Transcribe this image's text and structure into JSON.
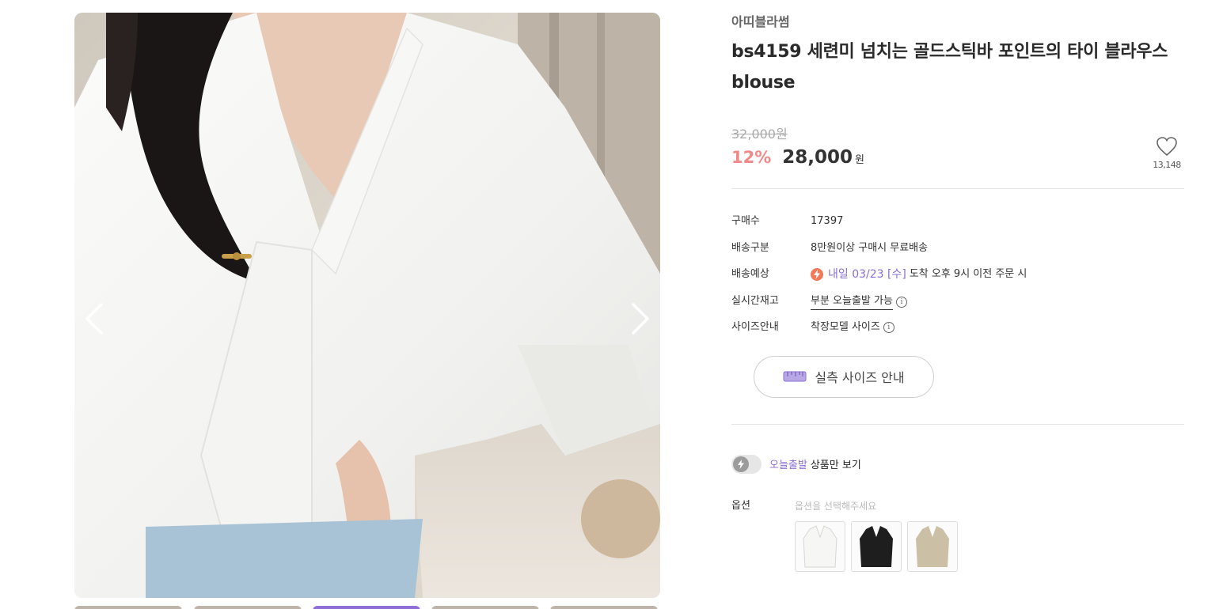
{
  "product": {
    "brand": "아띠블라썸",
    "title": "bs4159 세련미 넘치는 골드스틱바 포인트의 타이 블라우스 blouse",
    "original_price": "32,000원",
    "discount": "12%",
    "price": "28,000",
    "currency": "원",
    "like_count": "13,148"
  },
  "specs": {
    "purchases": {
      "label": "구매수",
      "value": "17397"
    },
    "shipping_type": {
      "label": "배송구분",
      "value": "8만원이상 구매시 무료배송"
    },
    "delivery": {
      "label": "배송예상",
      "highlight": "내일 03/23 [수]",
      "rest": "도착 오후 9시 이전 주문 시"
    },
    "stock": {
      "label": "실시간재고",
      "value": "부분 오늘출발 가능"
    },
    "size_guide": {
      "label": "사이즈안내",
      "value": "착장모델 사이즈"
    }
  },
  "size_button": {
    "label": "실측 사이즈 안내"
  },
  "today_filter": {
    "highlight": "오늘출발",
    "rest": "상품만 보기"
  },
  "options": {
    "label": "옵션",
    "placeholder": "옵션을 선택해주세요",
    "swatches": [
      "white",
      "black",
      "beige"
    ]
  },
  "colors": {
    "accent": "#8a6fd0",
    "discount": "#f08a8a",
    "bolt": "#f07a5a"
  },
  "icons": [
    "chevron-left-icon",
    "chevron-right-icon",
    "heart-icon",
    "info-icon",
    "bolt-icon",
    "ruler-icon"
  ]
}
